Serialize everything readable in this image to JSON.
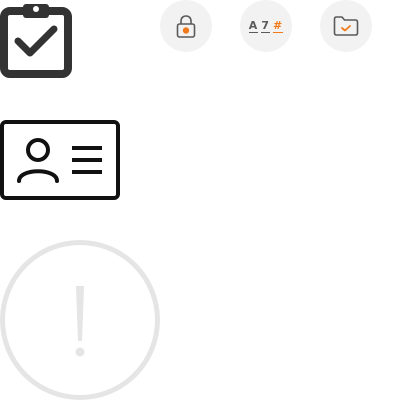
{
  "colors": {
    "icon_dark": "#333333",
    "icon_black": "#111111",
    "muted": "#e5e5e5",
    "button_bg": "#f2f2f2",
    "accent": "#f07a1a",
    "glyph_gray": "#5a5a5a"
  },
  "icons": {
    "clipboard": "clipboard-check-icon",
    "idcard": "id-card-icon",
    "alert": "alert-circle-icon",
    "lock": "lock-icon",
    "sort": "sort-alphanumeric-icon",
    "folder": "folder-check-icon"
  },
  "sort_glyph": {
    "letter": "A",
    "digit": "7",
    "symbol": "#"
  }
}
